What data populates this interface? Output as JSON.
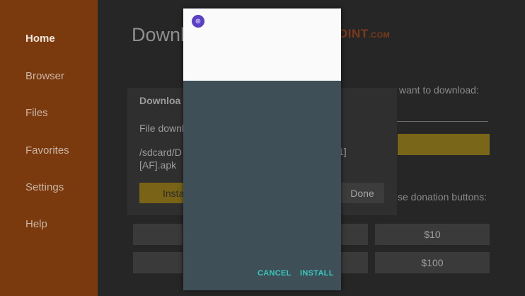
{
  "sidebar": {
    "items": [
      {
        "label": "Home",
        "active": true
      },
      {
        "label": "Browser"
      },
      {
        "label": "Files"
      },
      {
        "label": "Favorites"
      },
      {
        "label": "Settings"
      },
      {
        "label": "Help"
      }
    ]
  },
  "main": {
    "title": "Downl",
    "brand": "OINT",
    "brand_suffix": ".COM",
    "url_hint": "want to download:",
    "donation_hint": "se donation buttons:",
    "donations": [
      "$10",
      "$100"
    ]
  },
  "download_dialog": {
    "title": "Downloa",
    "status": "File downl",
    "path_line1": "/sdcard/D",
    "path_line2": "[AF].apk",
    "path_tail": "1]",
    "install_label": "Insta",
    "done_label": "Done"
  },
  "install_dialog": {
    "icon_glyph": "⊕",
    "app_name": "",
    "prompt_lines": [
      "",
      ""
    ],
    "cancel_label": "CANCEL",
    "install_label": "INSTALL"
  },
  "colors": {
    "sidebar": "#7a3a0d",
    "accent_button": "#786316",
    "dialog_button_text": "#39c8bf",
    "dialog_body": "#3e4f57"
  }
}
